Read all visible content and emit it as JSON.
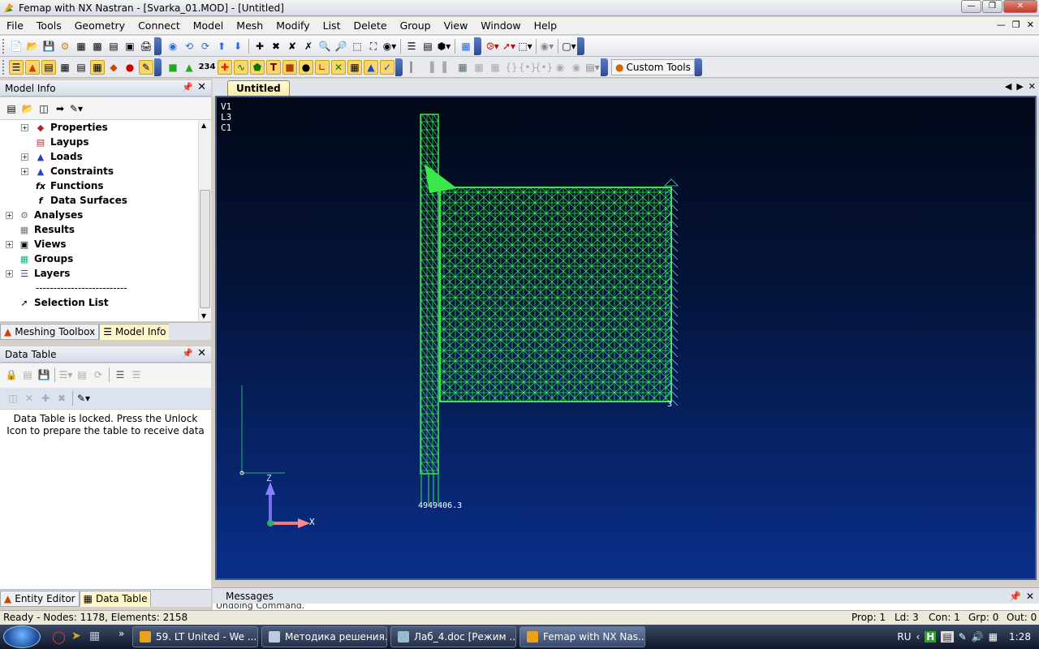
{
  "title": "Femap with NX Nastran - [Svarka_01.MOD] - [Untitled]",
  "menu": [
    "File",
    "Tools",
    "Geometry",
    "Connect",
    "Model",
    "Mesh",
    "Modify",
    "List",
    "Delete",
    "Group",
    "View",
    "Window",
    "Help"
  ],
  "toolbar": {
    "custom_tools": "Custom Tools",
    "node_count_button": "234"
  },
  "model_info": {
    "header": "Model Info",
    "tree": [
      {
        "label": "Properties"
      },
      {
        "label": "Layups"
      },
      {
        "label": "Loads"
      },
      {
        "label": "Constraints"
      },
      {
        "label": "Functions"
      },
      {
        "label": "Data Surfaces"
      },
      {
        "label": "Analyses"
      },
      {
        "label": "Results"
      },
      {
        "label": "Views"
      },
      {
        "label": "Groups"
      },
      {
        "label": "Layers"
      },
      {
        "label": "--------------------------"
      },
      {
        "label": "Selection List"
      }
    ],
    "tabs": [
      "Meshing Toolbox",
      "Model Info"
    ]
  },
  "data_table": {
    "header": "Data Table",
    "locked_message": "Data Table is locked. Press the Unlock Icon to prepare the table to receive data",
    "tabs": [
      "Entity Editor",
      "Data Table"
    ]
  },
  "view": {
    "tab": "Untitled",
    "legend": [
      "V1",
      "L3",
      "C1"
    ],
    "axis_z": "Z",
    "axis_x": "X",
    "node_label_right": "3",
    "node_labels_bottom": "4949406.3"
  },
  "messages": {
    "header": "Messages",
    "last_line": "Undoing Command."
  },
  "status": {
    "left": "Ready - Nodes: 1178,  Elements: 2158",
    "prop": "Prop: 1",
    "ld": "Ld: 3",
    "con": "Con: 1",
    "grp": "Grp: 0",
    "out": "Out: 0"
  },
  "taskbar": {
    "tasks": [
      "59. LT United - We ...",
      "Методика решения...",
      "Лаб_4.doc [Режим ...",
      "Femap with NX Nas..."
    ],
    "lang": "RU",
    "time": "1:28"
  }
}
